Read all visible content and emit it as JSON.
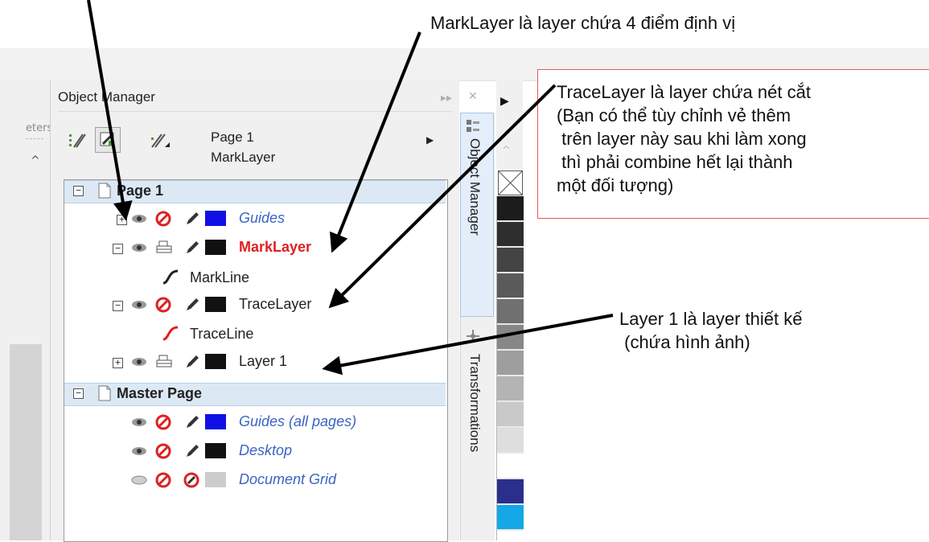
{
  "annotations": {
    "marklayer_note": "MarkLayer là layer chứa 4 điểm định vị",
    "tracelayer_note": "TraceLayer là layer chứa nét cắt\n(Bạn có thể tùy chỉnh vẻ thêm\n trên layer này sau khi làm xong\n thì phải combine hết lại thành\nmột đối tượng)",
    "layer1_note": "Layer 1 là layer thiết kế\n (chứa hình ảnh)"
  },
  "left_panel": {
    "truncated_label": "eters",
    "scroll_up": "^"
  },
  "object_manager": {
    "title": "Object Manager",
    "ctrl_dock": "▸▸",
    "ctrl_close": "✕",
    "page_info": {
      "page": "Page 1",
      "layer": "MarkLayer"
    },
    "tree": {
      "page1": "Page 1",
      "guides": "Guides",
      "marklayer": "MarkLayer",
      "markline": "MarkLine",
      "tracelayer": "TraceLayer",
      "traceline": "TraceLine",
      "layer1": "Layer 1",
      "master_page": "Master Page",
      "guides_all": "Guides (all pages)",
      "desktop": "Desktop",
      "document_grid": "Document Grid"
    }
  },
  "side_tabs": {
    "object_manager": "Object Manager",
    "transformations": "Transformations"
  },
  "palette": {
    "colors": [
      "#1c1c1c",
      "#2e2e2e",
      "#444444",
      "#5a5a5a",
      "#707070",
      "#878787",
      "#9e9e9e",
      "#b4b4b4",
      "#c9c9c9",
      "#dedede",
      "#ffffff",
      "#2a2f8c",
      "#14a8e6"
    ]
  },
  "colors": {
    "guides_swatch": "#1010e6",
    "layer_swatch": "#111111",
    "grid_swatch": "#cccccc",
    "active_layer": "#e02020",
    "callout_border": "#e05a5a"
  }
}
